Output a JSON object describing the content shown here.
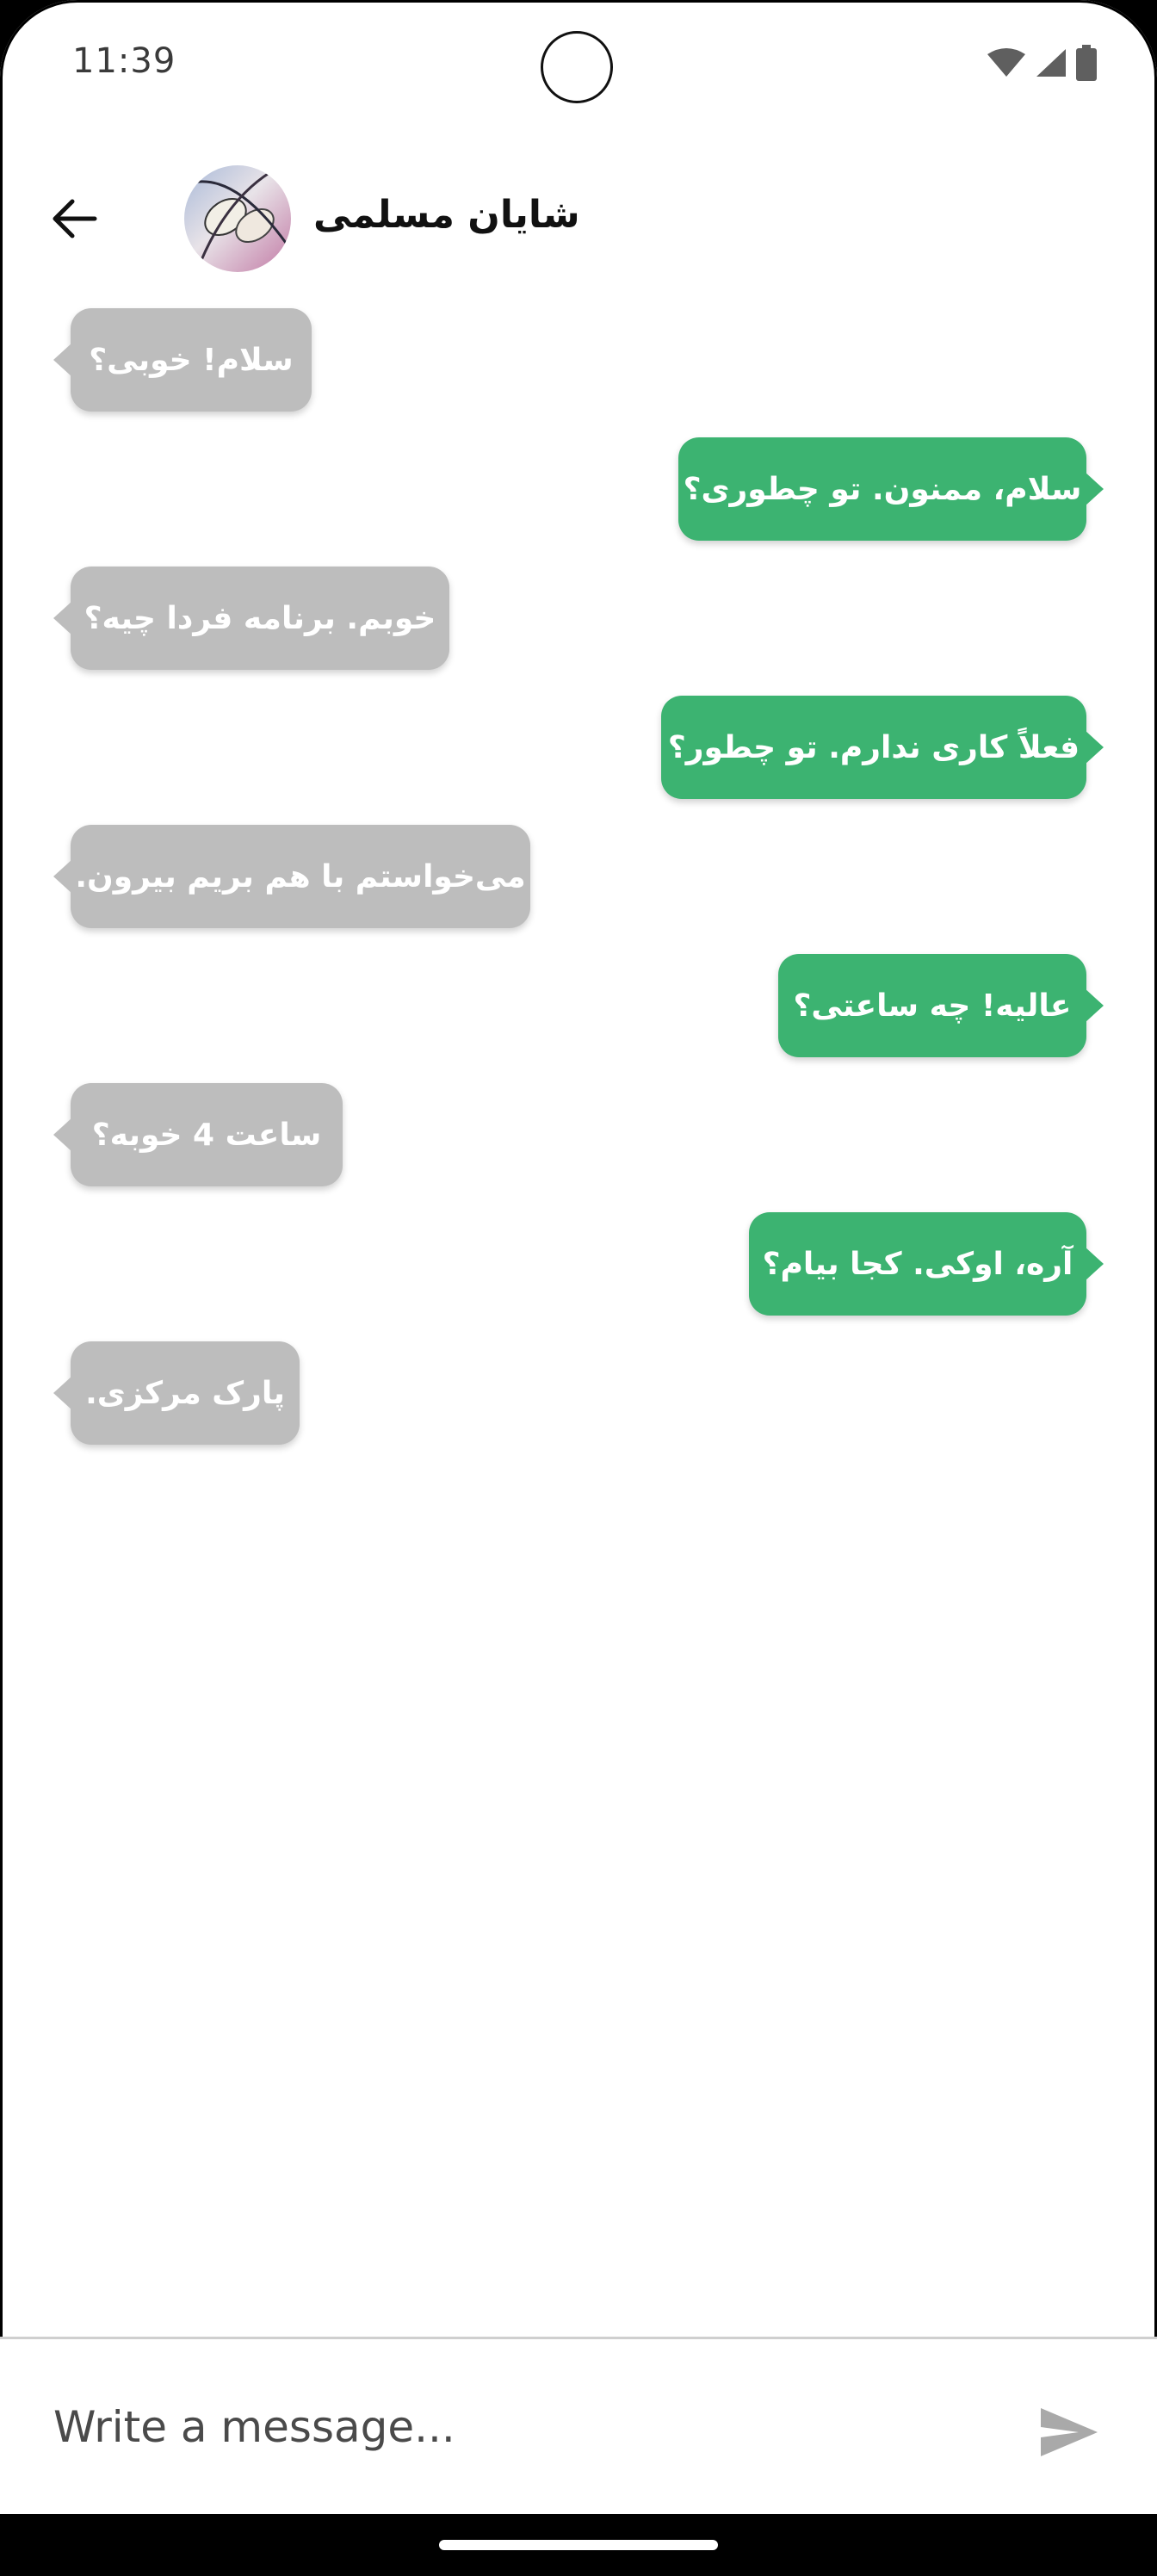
{
  "status_bar": {
    "time": "11:39",
    "icons": [
      "wifi-icon",
      "signal-icon",
      "battery-icon"
    ]
  },
  "header": {
    "back_icon": "arrow-left-icon",
    "contact_name": "شایان مسلمی"
  },
  "messages": [
    {
      "side": "in",
      "text": "سلام! خوبی؟"
    },
    {
      "side": "out",
      "text": "سلام، ممنون. تو چطوری؟"
    },
    {
      "side": "in",
      "text": "خوبم. برنامه فردا چیه؟"
    },
    {
      "side": "out",
      "text": "فعلاً کاری ندارم. تو چطور؟"
    },
    {
      "side": "in",
      "text": "می‌خواستم با هم بریم بیرون."
    },
    {
      "side": "out",
      "text": "عالیه! چه ساعتی؟"
    },
    {
      "side": "in",
      "text": "ساعت 4 خوبه؟"
    },
    {
      "side": "out",
      "text": "آره، اوکی. کجا بیام؟"
    },
    {
      "side": "in",
      "text": "پارک مرکزی."
    }
  ],
  "composer": {
    "placeholder": "Write a message...",
    "send_icon": "send-icon"
  },
  "colors": {
    "incoming_bubble": "#bdbdbd",
    "outgoing_bubble": "#3cb371",
    "background": "#ffffff"
  }
}
